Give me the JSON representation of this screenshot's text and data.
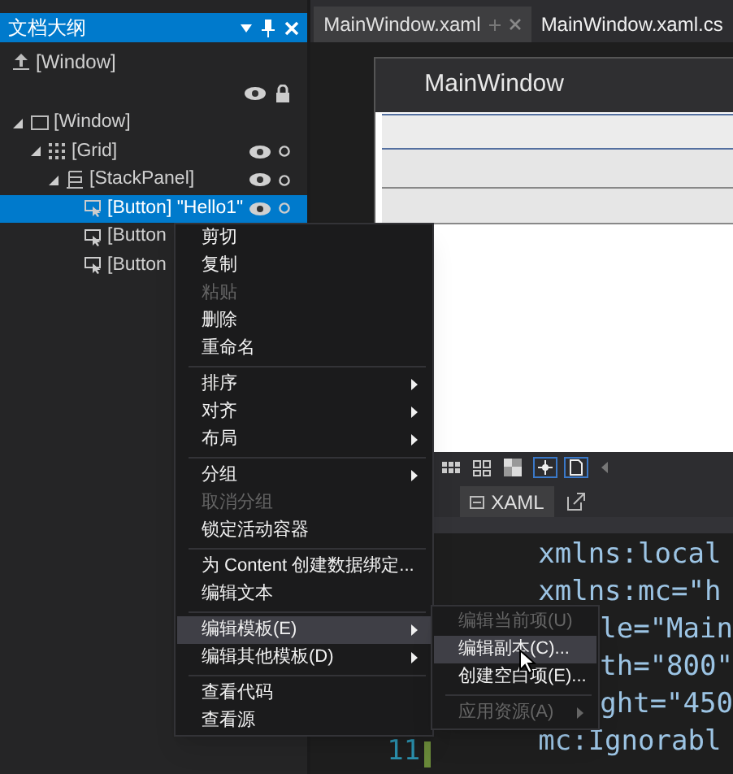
{
  "outline_panel": {
    "title": "文档大纲",
    "root_label": "[Window]",
    "tree": [
      {
        "label": "[Window]",
        "kind": "window",
        "expanded": true,
        "selected": false,
        "toggles": false,
        "children": [
          {
            "label": "[Grid]",
            "kind": "grid",
            "expanded": true,
            "selected": false,
            "toggles": true,
            "children": [
              {
                "label": "[StackPanel]",
                "kind": "stack",
                "expanded": true,
                "selected": false,
                "toggles": true,
                "children": [
                  {
                    "label": "[Button] \"Hello1\"",
                    "kind": "button",
                    "selected": true,
                    "toggles": true
                  },
                  {
                    "label": "[Button",
                    "kind": "button",
                    "selected": false
                  },
                  {
                    "label": "[Button",
                    "kind": "button",
                    "selected": false
                  }
                ]
              }
            ]
          }
        ]
      }
    ]
  },
  "editor_tabs": [
    {
      "label": "MainWindow.xaml",
      "selected": true
    },
    {
      "label": "MainWindow.xaml.cs",
      "selected": false
    }
  ],
  "designer": {
    "window_title": "MainWindow"
  },
  "xaml_tab": {
    "label": "XAML"
  },
  "code": {
    "line_number": "11",
    "lines": [
      {
        "text": "xmlns:local",
        "partly_hidden": false
      },
      {
        "text": "xmlns:mc=\"h",
        "partly_hidden": false
      },
      {
        "text": "le=\"Main",
        "partly_hidden": true
      },
      {
        "text": "th=\"800\"",
        "partly_hidden": true
      },
      {
        "text": "ght=\"450",
        "partly_hidden": true
      },
      {
        "text": "mc:Ignorabl",
        "partly_hidden": false
      }
    ]
  },
  "context_menu": [
    {
      "kind": "item",
      "label": "剪切",
      "disabled": false,
      "submenu": false,
      "selected": false
    },
    {
      "kind": "item",
      "label": "复制",
      "disabled": false,
      "submenu": false,
      "selected": false
    },
    {
      "kind": "item",
      "label": "粘贴",
      "disabled": true,
      "submenu": false,
      "selected": false
    },
    {
      "kind": "item",
      "label": "删除",
      "disabled": false,
      "submenu": false,
      "selected": false
    },
    {
      "kind": "item",
      "label": "重命名",
      "disabled": false,
      "submenu": false,
      "selected": false
    },
    {
      "kind": "separator"
    },
    {
      "kind": "item",
      "label": "排序",
      "disabled": false,
      "submenu": true,
      "selected": false
    },
    {
      "kind": "item",
      "label": "对齐",
      "disabled": false,
      "submenu": true,
      "selected": false
    },
    {
      "kind": "item",
      "label": "布局",
      "disabled": false,
      "submenu": true,
      "selected": false
    },
    {
      "kind": "separator"
    },
    {
      "kind": "item",
      "label": "分组",
      "disabled": false,
      "submenu": true,
      "selected": false
    },
    {
      "kind": "item",
      "label": "取消分组",
      "disabled": true,
      "submenu": false,
      "selected": false
    },
    {
      "kind": "item",
      "label": "锁定活动容器",
      "disabled": false,
      "submenu": false,
      "selected": false
    },
    {
      "kind": "separator"
    },
    {
      "kind": "item",
      "label": "为 Content 创建数据绑定...",
      "disabled": false,
      "submenu": false,
      "selected": false
    },
    {
      "kind": "item",
      "label": "编辑文本",
      "disabled": false,
      "submenu": false,
      "selected": false
    },
    {
      "kind": "separator"
    },
    {
      "kind": "item",
      "label": "编辑模板(E)",
      "disabled": false,
      "submenu": true,
      "selected": true
    },
    {
      "kind": "item",
      "label": "编辑其他模板(D)",
      "disabled": false,
      "submenu": true,
      "selected": false
    },
    {
      "kind": "separator"
    },
    {
      "kind": "item",
      "label": "查看代码",
      "disabled": false,
      "submenu": false,
      "selected": false
    },
    {
      "kind": "item",
      "label": "查看源",
      "disabled": false,
      "submenu": false,
      "selected": false
    }
  ],
  "submenu": [
    {
      "kind": "item",
      "label": "编辑当前项(U)",
      "disabled": true,
      "submenu": false,
      "selected": false
    },
    {
      "kind": "item",
      "label": "编辑副本(C)...",
      "disabled": false,
      "submenu": false,
      "selected": true
    },
    {
      "kind": "item",
      "label": "创建空白项(E)...",
      "disabled": false,
      "submenu": false,
      "selected": false
    },
    {
      "kind": "separator"
    },
    {
      "kind": "item",
      "label": "应用资源(A)",
      "disabled": true,
      "submenu": true,
      "selected": false
    }
  ]
}
